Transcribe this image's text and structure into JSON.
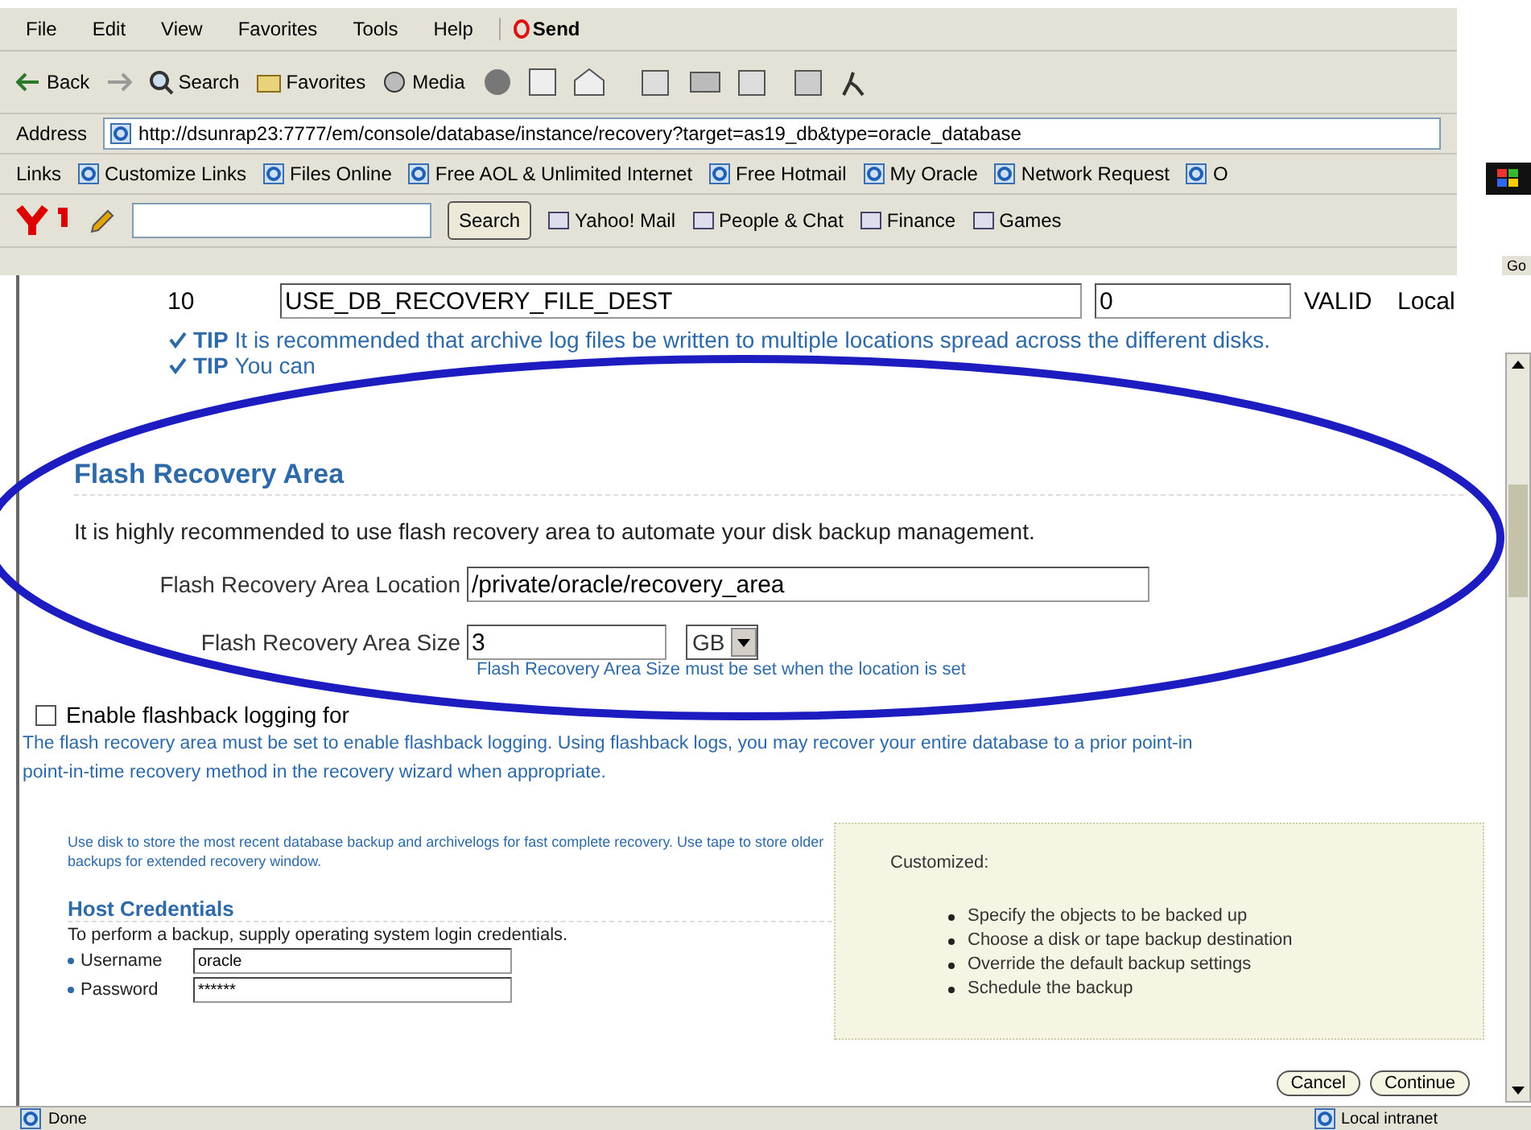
{
  "menu": [
    "File",
    "Edit",
    "View",
    "Favorites",
    "Tools",
    "Help"
  ],
  "send_label": "Send",
  "toolbar": [
    {
      "label": "Back",
      "kind": "back"
    },
    {
      "kind": "forward"
    },
    {
      "label": "Search",
      "kind": "search"
    },
    {
      "label": "Favorites",
      "kind": "favorites"
    },
    {
      "label": "Media",
      "kind": "media"
    }
  ],
  "address": {
    "label": "Address",
    "url": "http://dsunrap23:7777/em/console/database/instance/recovery?target=as19_db&type=oracle_database"
  },
  "links": {
    "label": "Links",
    "items": [
      "Customize Links",
      "Files Online",
      "Free AOL & Unlimited Internet",
      "Free Hotmail",
      "My Oracle",
      "Network Request",
      "O"
    ]
  },
  "yahoo": {
    "search_button": "Search",
    "items": [
      "Yahoo! Mail",
      "People & Chat",
      "Finance",
      "Games"
    ]
  },
  "go": "Go",
  "archive_row": {
    "number": "10",
    "destination": "USE_DB_RECOVERY_FILE_DEST",
    "quota": "0",
    "status": "VALID",
    "type": "Local"
  },
  "tips": [
    {
      "label": "TIP",
      "text": "It is recommended that archive log files be written to multiple locations spread across the different disks."
    },
    {
      "label": "TIP",
      "text": "You can"
    }
  ],
  "flash": {
    "title": "Flash Recovery Area",
    "description": "It is highly recommended to use flash recovery area to automate your disk backup management.",
    "location_label": "Flash Recovery Area Location",
    "location_value": "/private/oracle/recovery_area",
    "size_label": "Flash Recovery Area Size",
    "size_value": "3",
    "unit": "GB",
    "hint": "Flash Recovery Area Size must be set when the location is set"
  },
  "flashback": {
    "label": "Enable flashback logging for",
    "checked": false,
    "note": "The flash recovery area must be set to enable flashback logging. Using flashback logs, you may recover your entire database to a prior point-in",
    "note2": "point-in-time recovery method in the recovery wizard when appropriate."
  },
  "backup_note": "Use disk to store the most recent database backup and archivelogs for fast complete recovery. Use tape to store older backups for extended recovery window.",
  "host": {
    "title": "Host Credentials",
    "description": "To perform a backup, supply operating system login credentials.",
    "fields": [
      {
        "label": "Username",
        "value": "oracle",
        "required": true
      },
      {
        "label": "Password",
        "value": "******",
        "required": true
      }
    ]
  },
  "customized": {
    "title": "Customized:",
    "items": [
      "Specify the objects to be backed up",
      "Choose a disk or tape backup destination",
      "Override the default backup settings",
      "Schedule the backup"
    ]
  },
  "buttons": [
    "Cancel",
    "Continue"
  ],
  "status": {
    "left": "Done",
    "zone": "Local intranet"
  }
}
